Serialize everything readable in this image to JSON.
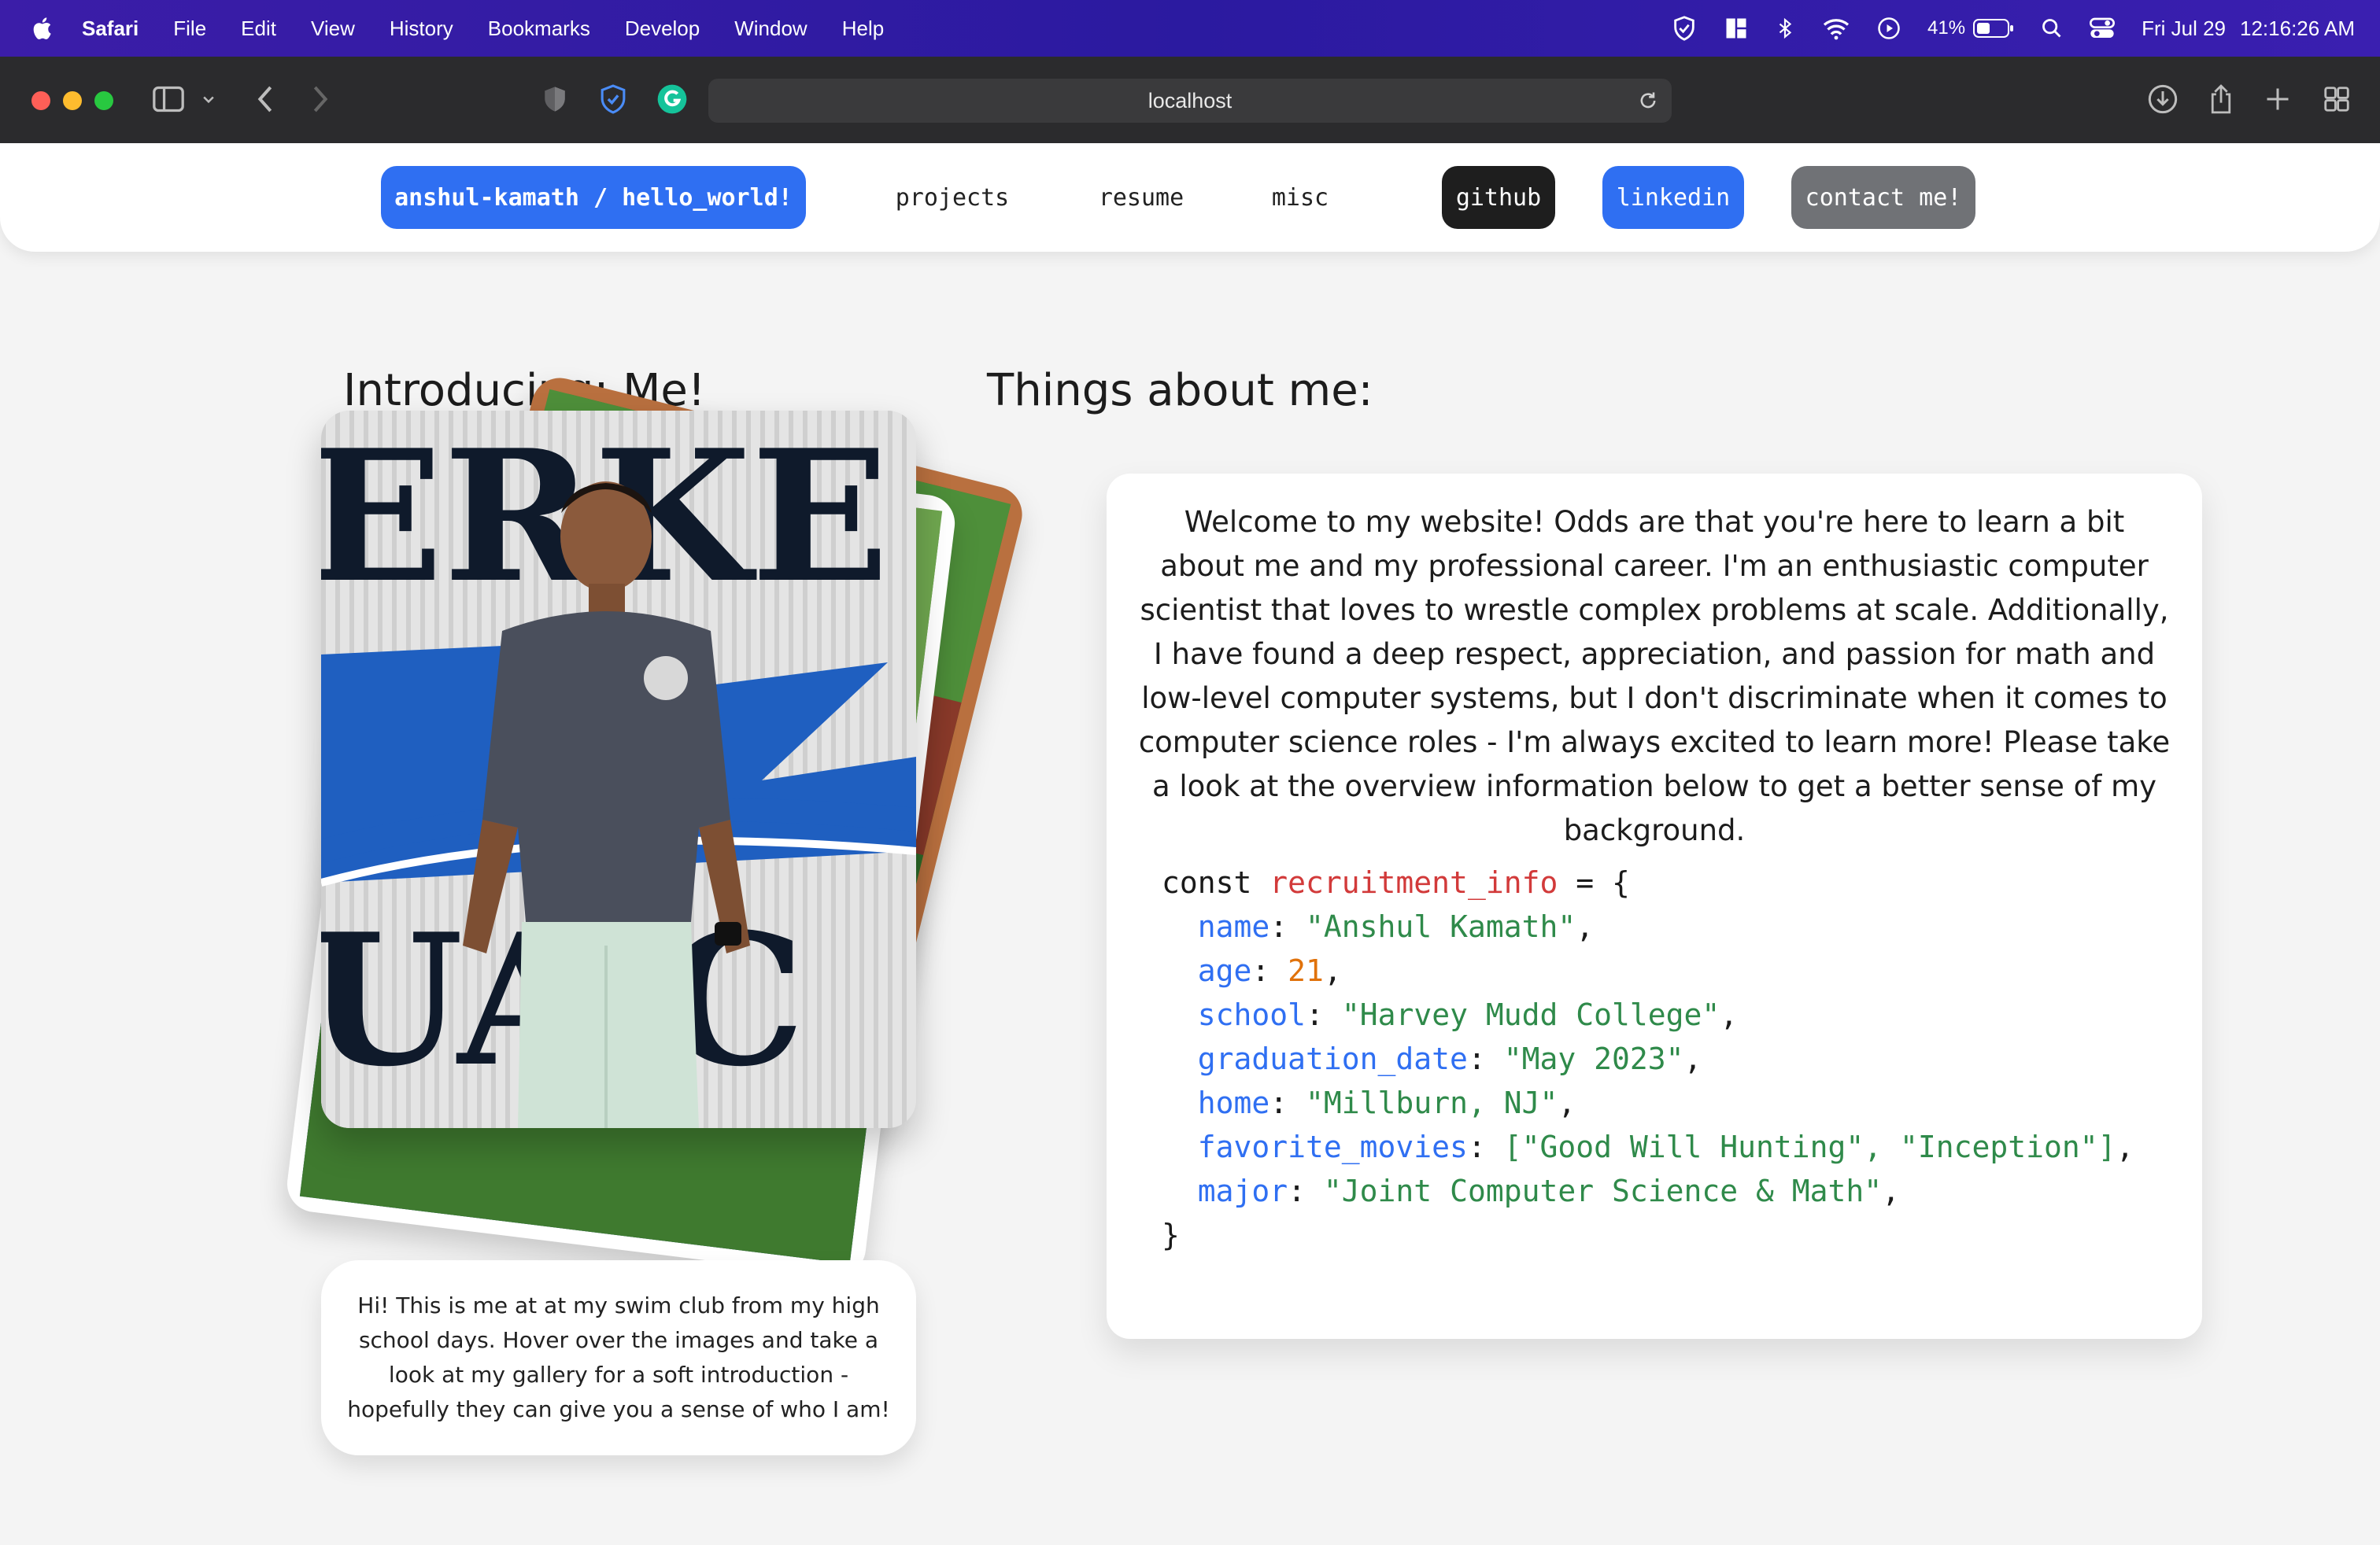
{
  "menubar": {
    "app": "Safari",
    "items": [
      "File",
      "Edit",
      "View",
      "History",
      "Bookmarks",
      "Develop",
      "Window",
      "Help"
    ],
    "battery": "41%",
    "date": "Fri Jul 29",
    "time": "12:16:26 AM"
  },
  "browser": {
    "url": "localhost"
  },
  "nav": {
    "brand": "anshul-kamath / hello_world!",
    "links": [
      "projects",
      "resume",
      "misc"
    ],
    "github": "github",
    "linkedin": "linkedin",
    "contact": "contact me!"
  },
  "left": {
    "heading": "Introducing: Me!",
    "caption": "Hi! This is me at at my swim club from my high school days. Hover over the images and take a look at my gallery for a soft introduction - hopefully they can give you a sense of who I am!"
  },
  "right": {
    "heading": "Things about me:",
    "intro": "Welcome to my website! Odds are that you're here to learn a bit about me and my professional career. I'm an enthusiastic computer scientist that loves to wrestle complex problems at scale. Additionally, I have found a deep respect, appreciation, and passion for math and low-level computer systems, but I don't discriminate when it comes to computer science roles - I'm always excited to learn more! Please take a look at the overview information below to get a better sense of my background.",
    "code": {
      "keyword": "const",
      "var_name": "recruitment_info",
      "open": " = {",
      "close": "}",
      "fields": [
        {
          "key": "name",
          "value": "\"Anshul Kamath\"",
          "kind": "string"
        },
        {
          "key": "age",
          "value": "21",
          "kind": "number"
        },
        {
          "key": "school",
          "value": "\"Harvey Mudd College\"",
          "kind": "string"
        },
        {
          "key": "graduation_date",
          "value": "\"May 2023\"",
          "kind": "string"
        },
        {
          "key": "home",
          "value": "\"Millburn, NJ\"",
          "kind": "string"
        },
        {
          "key": "favorite_movies",
          "value": "[\"Good Will Hunting\", \"Inception\"]",
          "kind": "string"
        },
        {
          "key": "major",
          "value": "\"Joint Computer Science & Math\"",
          "kind": "string"
        }
      ]
    }
  },
  "photo": {
    "sign_text": "ERKE",
    "sign_text_lower": "UA  C"
  },
  "colors": {
    "accent": "#2f6ff2",
    "menubar": "#2b1aa0",
    "page_bg": "#f4f4f4"
  }
}
